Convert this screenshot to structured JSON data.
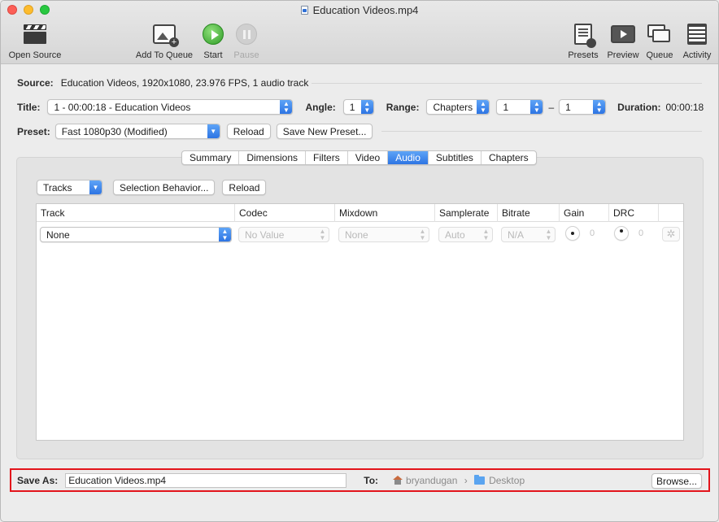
{
  "window": {
    "title": "Education Videos.mp4"
  },
  "toolbar": {
    "open_source": "Open Source",
    "add_to_queue": "Add To Queue",
    "start": "Start",
    "pause": "Pause",
    "presets": "Presets",
    "preview": "Preview",
    "queue": "Queue",
    "activity": "Activity"
  },
  "source": {
    "label": "Source:",
    "value": "Education Videos, 1920x1080, 23.976 FPS, 1 audio track"
  },
  "title_row": {
    "title_label": "Title:",
    "title_value": "1 - 00:00:18 - Education Videos",
    "angle_label": "Angle:",
    "angle_value": "1",
    "range_label": "Range:",
    "range_type": "Chapters",
    "range_start": "1",
    "range_dash": "–",
    "range_end": "1",
    "duration_label": "Duration:",
    "duration_value": "00:00:18"
  },
  "preset_row": {
    "label": "Preset:",
    "value": "Fast 1080p30 (Modified)",
    "reload": "Reload",
    "save_new": "Save New Preset..."
  },
  "tabs": [
    {
      "label": "Summary"
    },
    {
      "label": "Dimensions"
    },
    {
      "label": "Filters"
    },
    {
      "label": "Video"
    },
    {
      "label": "Audio",
      "active": true
    },
    {
      "label": "Subtitles"
    },
    {
      "label": "Chapters"
    }
  ],
  "audio": {
    "tracks_popup": "Tracks",
    "selection_behavior": "Selection Behavior...",
    "reload": "Reload",
    "columns": [
      "Track",
      "Codec",
      "Mixdown",
      "Samplerate",
      "Bitrate",
      "Gain",
      "DRC"
    ],
    "row": {
      "track": "None",
      "codec": "No Value",
      "mixdown": "None",
      "samplerate": "Auto",
      "bitrate": "N/A",
      "gain": "0",
      "drc": "0"
    }
  },
  "save": {
    "label": "Save As:",
    "filename": "Education Videos.mp4",
    "to_label": "To:",
    "user": "bryandugan",
    "path_sep": "›",
    "folder": "Desktop",
    "browse": "Browse..."
  },
  "colors": {
    "accent": "#2d74e3",
    "highlight_box": "#e3141b",
    "play_green": "#2f9c27"
  }
}
